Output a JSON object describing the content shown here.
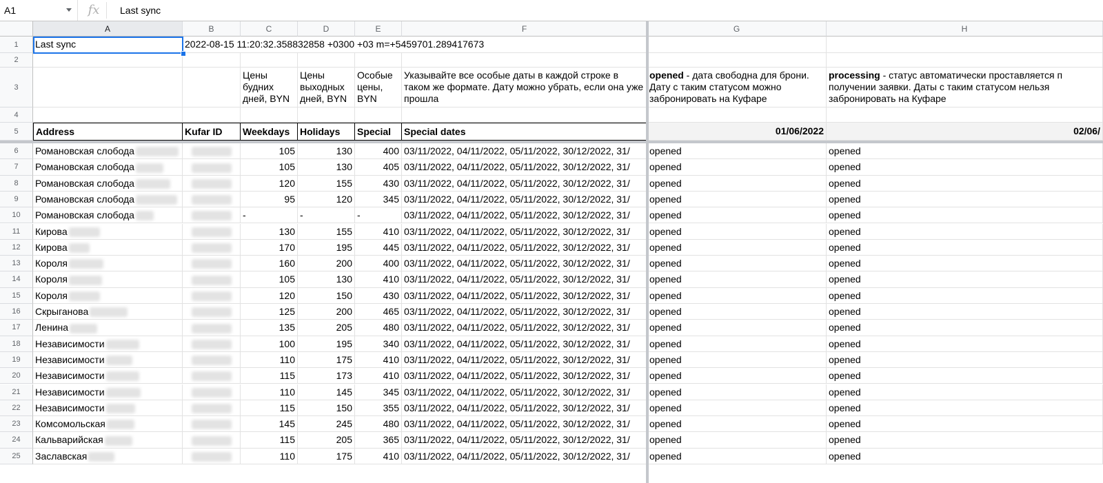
{
  "formula_bar": {
    "name_box": "A1",
    "fx_icon": "fx",
    "formula": "Last sync"
  },
  "columns": [
    "A",
    "B",
    "C",
    "D",
    "E",
    "F",
    "G",
    "H"
  ],
  "rows": {
    "r1": {
      "a": "Last sync",
      "b": "2022-08-15 11:20:32.358832858 +0300 +03 m=+5459701.289417673"
    },
    "r3": {
      "c": "Цены будних дней, BYN",
      "d": "Цены выходных дней, BYN",
      "e": "Особые цены, BYN",
      "f": "Указывайте все особые даты в каждой строке в таком же формате. Дату можно убрать, если она уже прошла",
      "g_bold": "opened",
      "g_rest": " - дата свободна для брони. Дату с таким статусом можно забронировать на Куфаре",
      "h_bold": "processing",
      "h_rest": " - статус автоматически проставляется п получении заявки. Даты с таким статусом нельзя забронировать на Куфаре"
    },
    "r5": {
      "a": "Address",
      "b": "Kufar ID",
      "c": "Weekdays",
      "d": "Holidays",
      "e": "Special",
      "f": "Special dates",
      "g": "01/06/2022",
      "h": "02/06/"
    }
  },
  "data_rows": [
    {
      "n": "6",
      "addr": "Романовская слобода",
      "wd": "105",
      "hd": "130",
      "sp": "400",
      "dates": "03/11/2022, 04/11/2022, 05/11/2022, 30/12/2022, 31/",
      "g": "opened",
      "h": "opened"
    },
    {
      "n": "7",
      "addr": "Романовская слобода",
      "wd": "105",
      "hd": "130",
      "sp": "405",
      "dates": "03/11/2022, 04/11/2022, 05/11/2022, 30/12/2022, 31/",
      "g": "opened",
      "h": "opened"
    },
    {
      "n": "8",
      "addr": "Романовская слобода",
      "wd": "120",
      "hd": "155",
      "sp": "430",
      "dates": "03/11/2022, 04/11/2022, 05/11/2022, 30/12/2022, 31/",
      "g": "opened",
      "h": "opened"
    },
    {
      "n": "9",
      "addr": "Романовская слобода",
      "wd": "95",
      "hd": "120",
      "sp": "345",
      "dates": "03/11/2022, 04/11/2022, 05/11/2022, 30/12/2022, 31/",
      "g": "opened",
      "h": "opened"
    },
    {
      "n": "10",
      "addr": "Романовская слобода",
      "wd": "-",
      "hd": "-",
      "sp": "-",
      "dates": "03/11/2022, 04/11/2022, 05/11/2022, 30/12/2022, 31/",
      "g": "opened",
      "h": "opened"
    },
    {
      "n": "11",
      "addr": "Кирова",
      "wd": "130",
      "hd": "155",
      "sp": "410",
      "dates": "03/11/2022, 04/11/2022, 05/11/2022, 30/12/2022, 31/",
      "g": "opened",
      "h": "opened"
    },
    {
      "n": "12",
      "addr": "Кирова",
      "wd": "170",
      "hd": "195",
      "sp": "445",
      "dates": "03/11/2022, 04/11/2022, 05/11/2022, 30/12/2022, 31/",
      "g": "opened",
      "h": "opened"
    },
    {
      "n": "13",
      "addr": "Короля",
      "wd": "160",
      "hd": "200",
      "sp": "400",
      "dates": "03/11/2022, 04/11/2022, 05/11/2022, 30/12/2022, 31/",
      "g": "opened",
      "h": "opened"
    },
    {
      "n": "14",
      "addr": "Короля",
      "wd": "105",
      "hd": "130",
      "sp": "410",
      "dates": "03/11/2022, 04/11/2022, 05/11/2022, 30/12/2022, 31/",
      "g": "opened",
      "h": "opened"
    },
    {
      "n": "15",
      "addr": "Короля",
      "wd": "120",
      "hd": "150",
      "sp": "430",
      "dates": "03/11/2022, 04/11/2022, 05/11/2022, 30/12/2022, 31/",
      "g": "opened",
      "h": "opened"
    },
    {
      "n": "16",
      "addr": "Скрыганова",
      "wd": "125",
      "hd": "200",
      "sp": "465",
      "dates": "03/11/2022, 04/11/2022, 05/11/2022, 30/12/2022, 31/",
      "g": "opened",
      "h": "opened"
    },
    {
      "n": "17",
      "addr": "Ленина",
      "wd": "135",
      "hd": "205",
      "sp": "480",
      "dates": "03/11/2022, 04/11/2022, 05/11/2022, 30/12/2022, 31/",
      "g": "opened",
      "h": "opened"
    },
    {
      "n": "18",
      "addr": "Независимости",
      "wd": "100",
      "hd": "195",
      "sp": "340",
      "dates": "03/11/2022, 04/11/2022, 05/11/2022, 30/12/2022, 31/",
      "g": "opened",
      "h": "opened"
    },
    {
      "n": "19",
      "addr": "Независимости",
      "wd": "110",
      "hd": "175",
      "sp": "410",
      "dates": "03/11/2022, 04/11/2022, 05/11/2022, 30/12/2022, 31/",
      "g": "opened",
      "h": "opened"
    },
    {
      "n": "20",
      "addr": "Независимости",
      "wd": "115",
      "hd": "173",
      "sp": "410",
      "dates": "03/11/2022, 04/11/2022, 05/11/2022, 30/12/2022, 31/",
      "g": "opened",
      "h": "opened"
    },
    {
      "n": "21",
      "addr": "Независимости",
      "wd": "110",
      "hd": "145",
      "sp": "345",
      "dates": "03/11/2022, 04/11/2022, 05/11/2022, 30/12/2022, 31/",
      "g": "opened",
      "h": "opened"
    },
    {
      "n": "22",
      "addr": "Независимости",
      "wd": "115",
      "hd": "150",
      "sp": "355",
      "dates": "03/11/2022, 04/11/2022, 05/11/2022, 30/12/2022, 31/",
      "g": "opened",
      "h": "opened"
    },
    {
      "n": "23",
      "addr": "Комсомольская",
      "wd": "145",
      "hd": "245",
      "sp": "480",
      "dates": "03/11/2022, 04/11/2022, 05/11/2022, 30/12/2022, 31/",
      "g": "opened",
      "h": "opened"
    },
    {
      "n": "24",
      "addr": "Кальварийская",
      "wd": "115",
      "hd": "205",
      "sp": "365",
      "dates": "03/11/2022, 04/11/2022, 05/11/2022, 30/12/2022, 31/",
      "g": "opened",
      "h": "opened"
    },
    {
      "n": "25",
      "addr": "Заславская",
      "wd": "110",
      "hd": "175",
      "sp": "410",
      "dates": "03/11/2022, 04/11/2022, 05/11/2022, 30/12/2022, 31/",
      "g": "opened",
      "h": "opened"
    }
  ],
  "row_labels": [
    "1",
    "2",
    "3",
    "4",
    "5"
  ]
}
